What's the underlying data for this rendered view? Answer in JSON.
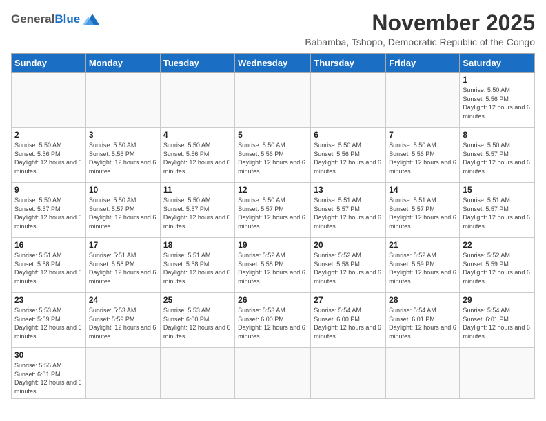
{
  "header": {
    "logo_general": "General",
    "logo_blue": "Blue",
    "month_title": "November 2025",
    "location": "Babamba, Tshopo, Democratic Republic of the Congo"
  },
  "weekdays": [
    "Sunday",
    "Monday",
    "Tuesday",
    "Wednesday",
    "Thursday",
    "Friday",
    "Saturday"
  ],
  "weeks": [
    [
      {
        "day": "",
        "info": ""
      },
      {
        "day": "",
        "info": ""
      },
      {
        "day": "",
        "info": ""
      },
      {
        "day": "",
        "info": ""
      },
      {
        "day": "",
        "info": ""
      },
      {
        "day": "",
        "info": ""
      },
      {
        "day": "1",
        "info": "Sunrise: 5:50 AM\nSunset: 5:56 PM\nDaylight: 12 hours and 6 minutes."
      }
    ],
    [
      {
        "day": "2",
        "info": "Sunrise: 5:50 AM\nSunset: 5:56 PM\nDaylight: 12 hours and 6 minutes."
      },
      {
        "day": "3",
        "info": "Sunrise: 5:50 AM\nSunset: 5:56 PM\nDaylight: 12 hours and 6 minutes."
      },
      {
        "day": "4",
        "info": "Sunrise: 5:50 AM\nSunset: 5:56 PM\nDaylight: 12 hours and 6 minutes."
      },
      {
        "day": "5",
        "info": "Sunrise: 5:50 AM\nSunset: 5:56 PM\nDaylight: 12 hours and 6 minutes."
      },
      {
        "day": "6",
        "info": "Sunrise: 5:50 AM\nSunset: 5:56 PM\nDaylight: 12 hours and 6 minutes."
      },
      {
        "day": "7",
        "info": "Sunrise: 5:50 AM\nSunset: 5:56 PM\nDaylight: 12 hours and 6 minutes."
      },
      {
        "day": "8",
        "info": "Sunrise: 5:50 AM\nSunset: 5:57 PM\nDaylight: 12 hours and 6 minutes."
      }
    ],
    [
      {
        "day": "9",
        "info": "Sunrise: 5:50 AM\nSunset: 5:57 PM\nDaylight: 12 hours and 6 minutes."
      },
      {
        "day": "10",
        "info": "Sunrise: 5:50 AM\nSunset: 5:57 PM\nDaylight: 12 hours and 6 minutes."
      },
      {
        "day": "11",
        "info": "Sunrise: 5:50 AM\nSunset: 5:57 PM\nDaylight: 12 hours and 6 minutes."
      },
      {
        "day": "12",
        "info": "Sunrise: 5:50 AM\nSunset: 5:57 PM\nDaylight: 12 hours and 6 minutes."
      },
      {
        "day": "13",
        "info": "Sunrise: 5:51 AM\nSunset: 5:57 PM\nDaylight: 12 hours and 6 minutes."
      },
      {
        "day": "14",
        "info": "Sunrise: 5:51 AM\nSunset: 5:57 PM\nDaylight: 12 hours and 6 minutes."
      },
      {
        "day": "15",
        "info": "Sunrise: 5:51 AM\nSunset: 5:57 PM\nDaylight: 12 hours and 6 minutes."
      }
    ],
    [
      {
        "day": "16",
        "info": "Sunrise: 5:51 AM\nSunset: 5:58 PM\nDaylight: 12 hours and 6 minutes."
      },
      {
        "day": "17",
        "info": "Sunrise: 5:51 AM\nSunset: 5:58 PM\nDaylight: 12 hours and 6 minutes."
      },
      {
        "day": "18",
        "info": "Sunrise: 5:51 AM\nSunset: 5:58 PM\nDaylight: 12 hours and 6 minutes."
      },
      {
        "day": "19",
        "info": "Sunrise: 5:52 AM\nSunset: 5:58 PM\nDaylight: 12 hours and 6 minutes."
      },
      {
        "day": "20",
        "info": "Sunrise: 5:52 AM\nSunset: 5:58 PM\nDaylight: 12 hours and 6 minutes."
      },
      {
        "day": "21",
        "info": "Sunrise: 5:52 AM\nSunset: 5:59 PM\nDaylight: 12 hours and 6 minutes."
      },
      {
        "day": "22",
        "info": "Sunrise: 5:52 AM\nSunset: 5:59 PM\nDaylight: 12 hours and 6 minutes."
      }
    ],
    [
      {
        "day": "23",
        "info": "Sunrise: 5:53 AM\nSunset: 5:59 PM\nDaylight: 12 hours and 6 minutes."
      },
      {
        "day": "24",
        "info": "Sunrise: 5:53 AM\nSunset: 5:59 PM\nDaylight: 12 hours and 6 minutes."
      },
      {
        "day": "25",
        "info": "Sunrise: 5:53 AM\nSunset: 6:00 PM\nDaylight: 12 hours and 6 minutes."
      },
      {
        "day": "26",
        "info": "Sunrise: 5:53 AM\nSunset: 6:00 PM\nDaylight: 12 hours and 6 minutes."
      },
      {
        "day": "27",
        "info": "Sunrise: 5:54 AM\nSunset: 6:00 PM\nDaylight: 12 hours and 6 minutes."
      },
      {
        "day": "28",
        "info": "Sunrise: 5:54 AM\nSunset: 6:01 PM\nDaylight: 12 hours and 6 minutes."
      },
      {
        "day": "29",
        "info": "Sunrise: 5:54 AM\nSunset: 6:01 PM\nDaylight: 12 hours and 6 minutes."
      }
    ],
    [
      {
        "day": "30",
        "info": "Sunrise: 5:55 AM\nSunset: 6:01 PM\nDaylight: 12 hours and 6 minutes."
      },
      {
        "day": "",
        "info": ""
      },
      {
        "day": "",
        "info": ""
      },
      {
        "day": "",
        "info": ""
      },
      {
        "day": "",
        "info": ""
      },
      {
        "day": "",
        "info": ""
      },
      {
        "day": "",
        "info": ""
      }
    ]
  ]
}
